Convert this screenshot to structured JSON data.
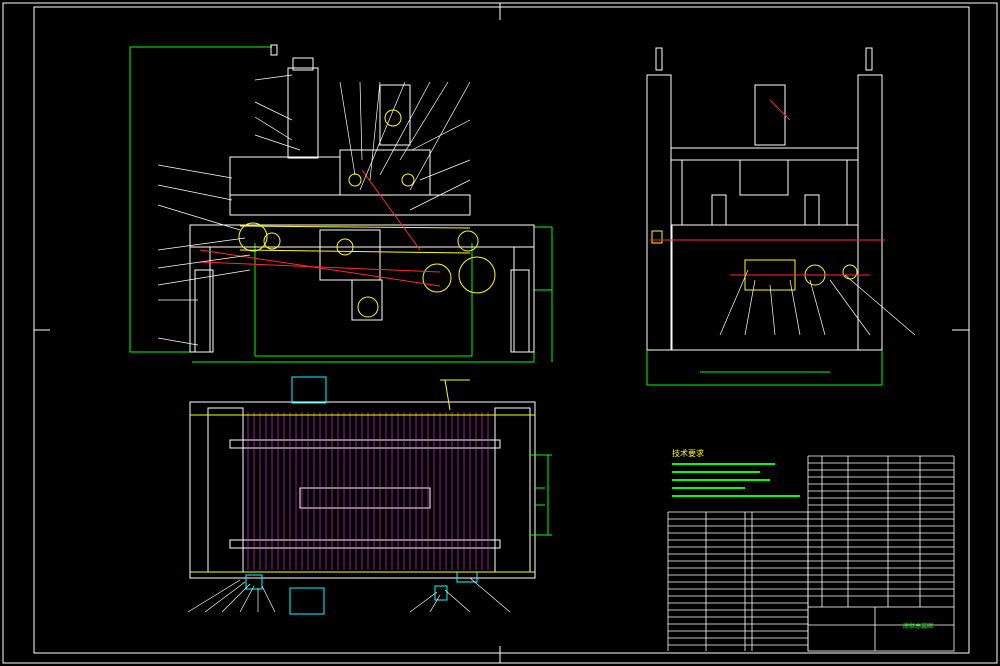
{
  "drawing": {
    "background": "#000000",
    "colors": {
      "outline": "#ffffff",
      "dimension": "#00ff00",
      "center_line": "#ff2a2a",
      "hidden": "#ffff00",
      "section": "#ff33ff",
      "parts": "#00ffff",
      "leader": "#ffffff"
    },
    "notes": {
      "title": "技术要求"
    },
    "title_block": {
      "drawing_name": "底框总装图"
    }
  }
}
